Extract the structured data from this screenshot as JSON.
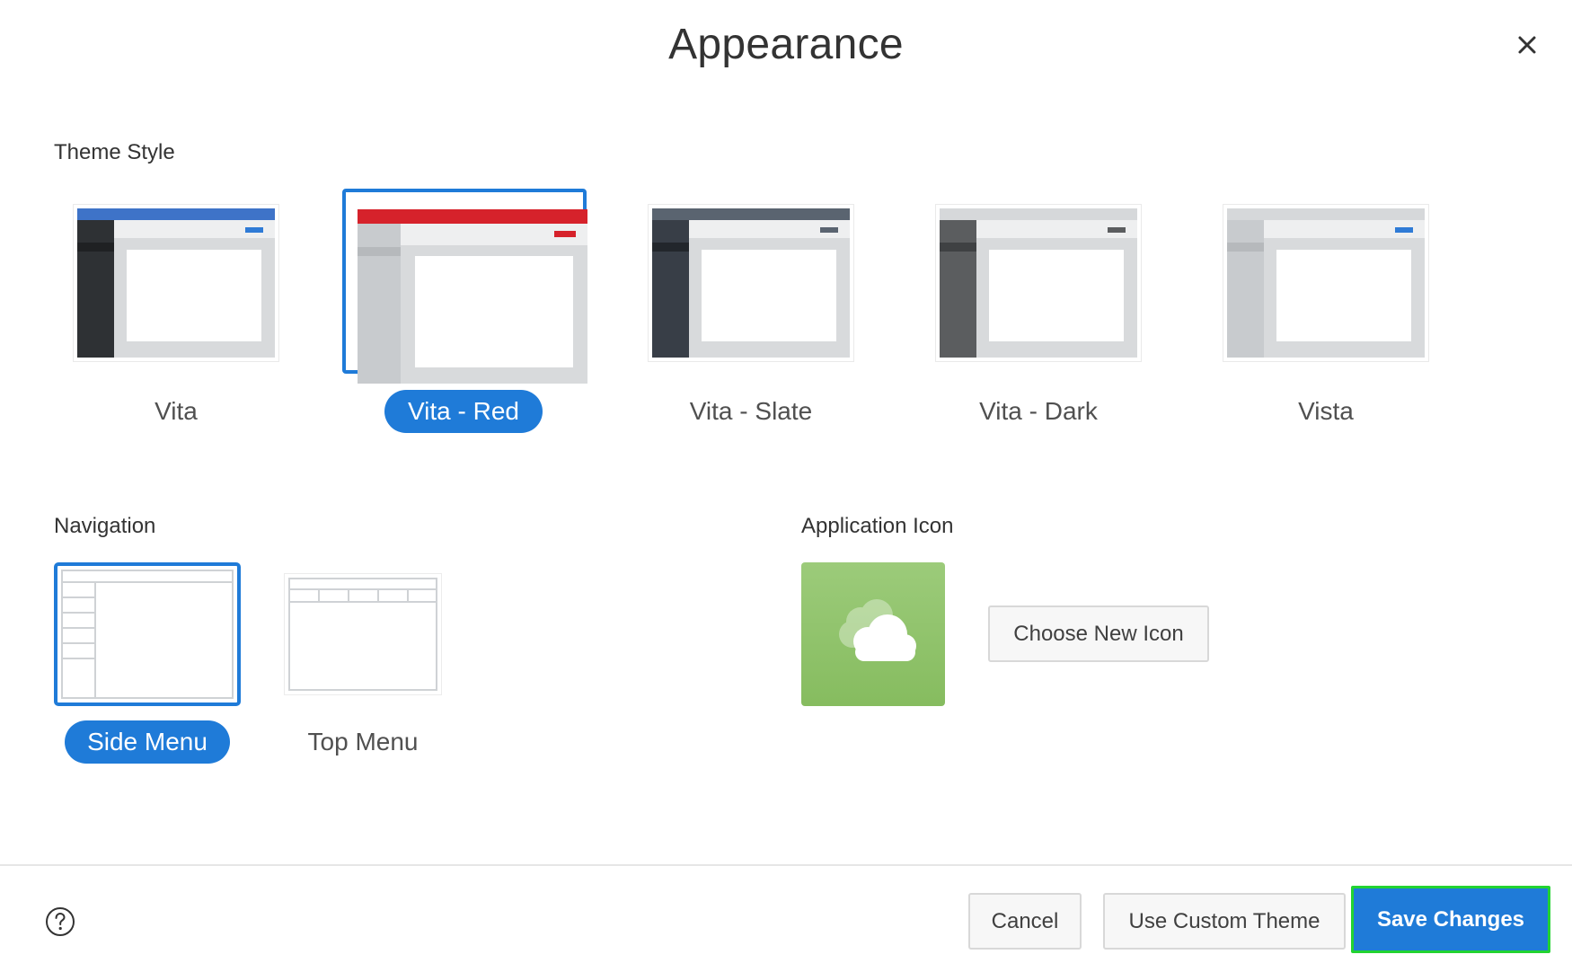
{
  "dialog": {
    "title": "Appearance",
    "close_label": "×"
  },
  "theme_style": {
    "label": "Theme Style",
    "options": [
      {
        "label": "Vita",
        "selected": false
      },
      {
        "label": "Vita - Red",
        "selected": true
      },
      {
        "label": "Vita - Slate",
        "selected": false
      },
      {
        "label": "Vita - Dark",
        "selected": false
      },
      {
        "label": "Vista",
        "selected": false
      }
    ]
  },
  "navigation": {
    "label": "Navigation",
    "options": [
      {
        "label": "Side Menu",
        "selected": true
      },
      {
        "label": "Top Menu",
        "selected": false
      }
    ]
  },
  "application_icon": {
    "label": "Application Icon",
    "icon": "cloud-icon",
    "choose_label": "Choose New Icon"
  },
  "footer": {
    "help_icon": "help-icon",
    "cancel_label": "Cancel",
    "custom_theme_label": "Use Custom Theme",
    "save_label": "Save Changes"
  },
  "colors": {
    "accent": "#1f7bd8",
    "vita_header": "#3e73c8",
    "red_header": "#d6222b",
    "slate_header": "#5a6470",
    "save_outline": "#22d331",
    "icon_bg": "#8ec26a"
  }
}
